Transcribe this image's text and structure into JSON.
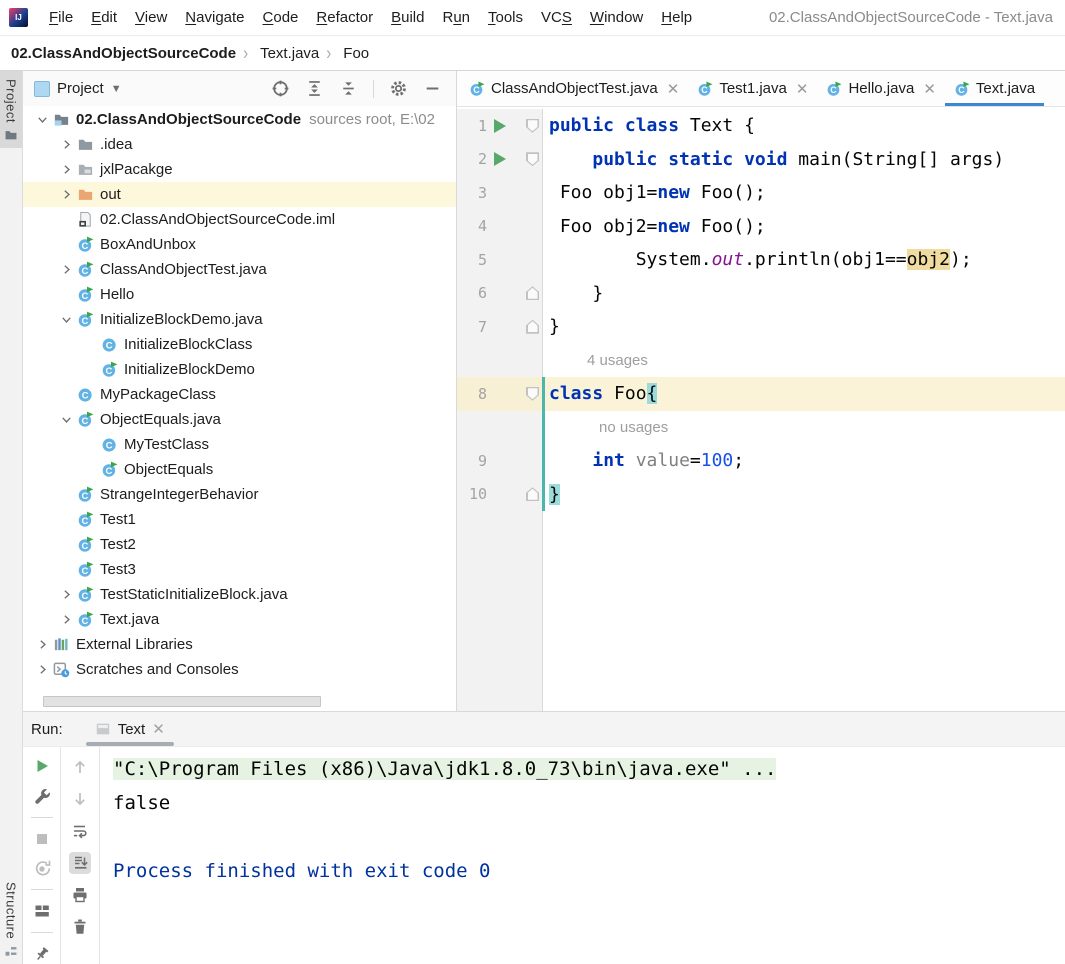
{
  "window": {
    "title": "02.ClassAndObjectSourceCode - Text.java"
  },
  "menubar": {
    "items": [
      "File",
      "Edit",
      "View",
      "Navigate",
      "Code",
      "Refactor",
      "Build",
      "Run",
      "Tools",
      "VCS",
      "Window",
      "Help"
    ],
    "mnemonics": [
      0,
      0,
      0,
      0,
      0,
      0,
      0,
      1,
      0,
      2,
      0,
      0
    ]
  },
  "breadcrumbs": [
    {
      "label": "02.ClassAndObjectSourceCode",
      "icon": null,
      "bold": true
    },
    {
      "label": "Text.java",
      "icon": "class-run",
      "bold": false
    },
    {
      "label": "Foo",
      "icon": "class",
      "bold": false
    }
  ],
  "left_stripe": {
    "top_label": "Project",
    "bottom_label": "Structure"
  },
  "project_panel": {
    "title": "Project",
    "toolbar_icons": [
      "locate",
      "expand-all",
      "collapse-all",
      "divider",
      "settings-gear",
      "hide"
    ],
    "tree": [
      {
        "label": "02.ClassAndObjectSourceCode",
        "hint": "sources root,  E:\\02",
        "icon": "folder-source",
        "chevron": "down",
        "level": 0,
        "bold": true
      },
      {
        "label": ".idea",
        "icon": "folder",
        "chevron": "right",
        "level": 1
      },
      {
        "label": "jxlPacakge",
        "icon": "folder-excluded",
        "chevron": "right",
        "level": 1
      },
      {
        "label": "out",
        "icon": "folder-out",
        "chevron": "right",
        "level": 1,
        "selected": true
      },
      {
        "label": "02.ClassAndObjectSourceCode.iml",
        "icon": "file-iml",
        "level": 1
      },
      {
        "label": "BoxAndUnbox",
        "icon": "class-run",
        "level": 1
      },
      {
        "label": "ClassAndObjectTest.java",
        "icon": "class-run",
        "chevron": "right",
        "level": 1
      },
      {
        "label": "Hello",
        "icon": "class-run",
        "level": 1
      },
      {
        "label": "InitializeBlockDemo.java",
        "icon": "class-run",
        "chevron": "down",
        "level": 1
      },
      {
        "label": "InitializeBlockClass",
        "icon": "class",
        "level": 2
      },
      {
        "label": "InitializeBlockDemo",
        "icon": "class-run",
        "level": 2
      },
      {
        "label": "MyPackageClass",
        "icon": "class",
        "level": 1
      },
      {
        "label": "ObjectEquals.java",
        "icon": "class-run",
        "chevron": "down",
        "level": 1
      },
      {
        "label": "MyTestClass",
        "icon": "class",
        "level": 2
      },
      {
        "label": "ObjectEquals",
        "icon": "class-run",
        "level": 2
      },
      {
        "label": "StrangeIntegerBehavior",
        "icon": "class-run",
        "level": 1
      },
      {
        "label": "Test1",
        "icon": "class-run",
        "level": 1
      },
      {
        "label": "Test2",
        "icon": "class-run",
        "level": 1
      },
      {
        "label": "Test3",
        "icon": "class-run",
        "level": 1
      },
      {
        "label": "TestStaticInitializeBlock.java",
        "icon": "class-run",
        "chevron": "right",
        "level": 1
      },
      {
        "label": "Text.java",
        "icon": "class-run",
        "chevron": "right",
        "level": 1
      },
      {
        "label": "External Libraries",
        "icon": "libraries",
        "chevron": "right",
        "level": 0
      },
      {
        "label": "Scratches and Consoles",
        "icon": "scratches",
        "chevron": "right",
        "level": 0
      }
    ]
  },
  "editor": {
    "tabs": [
      {
        "label": "ClassAndObjectTest.java",
        "icon": "class-run",
        "closable": true,
        "active": false
      },
      {
        "label": "Test1.java",
        "icon": "class-run",
        "closable": true,
        "active": false
      },
      {
        "label": "Hello.java",
        "icon": "class-run",
        "closable": true,
        "active": false
      },
      {
        "label": "Text.java",
        "icon": "class-run",
        "closable": false,
        "active": true
      }
    ],
    "rows": [
      {
        "type": "code",
        "num": "1",
        "run": true,
        "fold": "down",
        "segments": [
          [
            "public class",
            "kw"
          ],
          [
            " Text {",
            "plain"
          ]
        ]
      },
      {
        "type": "code",
        "num": "2",
        "run": true,
        "fold": "down",
        "segments": [
          [
            "    ",
            "plain"
          ],
          [
            "public static void",
            "kw"
          ],
          [
            " main(String[] args)",
            "plain"
          ]
        ]
      },
      {
        "type": "code",
        "num": "3",
        "segments": [
          [
            " Foo obj1=",
            "plain"
          ],
          [
            "new",
            "kw"
          ],
          [
            " Foo();",
            "plain"
          ]
        ]
      },
      {
        "type": "code",
        "num": "4",
        "segments": [
          [
            " Foo obj2=",
            "plain"
          ],
          [
            "new",
            "kw"
          ],
          [
            " Foo();",
            "plain"
          ]
        ]
      },
      {
        "type": "code",
        "num": "5",
        "segments": [
          [
            "        System.",
            "plain"
          ],
          [
            "out",
            "field"
          ],
          [
            ".println(obj1==",
            "plain"
          ],
          [
            "obj2",
            "hl"
          ],
          [
            ");",
            "plain"
          ]
        ]
      },
      {
        "type": "code",
        "num": "6",
        "fold": "up",
        "segments": [
          [
            "    }",
            "plain"
          ]
        ]
      },
      {
        "type": "code",
        "num": "7",
        "fold": "up",
        "segments": [
          [
            "}",
            "plain"
          ]
        ]
      },
      {
        "type": "inlay",
        "text": "4 usages",
        "indent": 38
      },
      {
        "type": "code",
        "num": "8",
        "fold": "down",
        "caret_row": true,
        "vcs": true,
        "segments": [
          [
            "class",
            "kw"
          ],
          [
            " Foo",
            "plain"
          ],
          [
            "{",
            "brace"
          ]
        ]
      },
      {
        "type": "inlay",
        "text": "no usages",
        "indent": 50,
        "vcs": true
      },
      {
        "type": "code",
        "num": "9",
        "vcs": true,
        "segments": [
          [
            "    ",
            "plain"
          ],
          [
            "int",
            "kw"
          ],
          [
            " ",
            "plain"
          ],
          [
            "value",
            "gray"
          ],
          [
            "=",
            "plain"
          ],
          [
            "100",
            "num"
          ],
          [
            ";",
            "plain"
          ]
        ]
      },
      {
        "type": "code",
        "num": "10",
        "fold": "up",
        "vcs": true,
        "segments": [
          [
            "}",
            "brace"
          ]
        ]
      }
    ]
  },
  "run_panel": {
    "label": "Run:",
    "tab": {
      "label": "Text",
      "icon": "console"
    },
    "toolbar_left": [
      {
        "name": "rerun"
      },
      {
        "name": "settings-wrench"
      },
      {
        "name": "divider"
      },
      {
        "name": "stop",
        "disabled": true
      },
      {
        "name": "restart-debug",
        "disabled": true
      },
      {
        "name": "divider"
      },
      {
        "name": "layout"
      },
      {
        "name": "divider"
      },
      {
        "name": "pin"
      }
    ],
    "toolbar_right": [
      {
        "name": "scroll-up",
        "disabled": true
      },
      {
        "name": "scroll-down",
        "disabled": true
      },
      {
        "name": "soft-wrap"
      },
      {
        "name": "scroll-end",
        "selected": true
      },
      {
        "name": "print"
      },
      {
        "name": "clear"
      }
    ],
    "console": [
      {
        "text": "\"C:\\Program Files (x86)\\Java\\jdk1.8.0_73\\bin\\java.exe\" ...",
        "style": "cmd"
      },
      {
        "text": "false",
        "style": "plain"
      },
      {
        "text": "",
        "style": "plain"
      },
      {
        "text": "Process finished with exit code 0",
        "style": "system"
      }
    ]
  },
  "colors": {
    "accent_blue": "#3d87d0",
    "keyword": "#0033b3",
    "number": "#1750eb",
    "static_field": "#871094",
    "unused_gray": "#808080",
    "caret_row": "#fbf3d8",
    "tree_selection": "#fdf7dc",
    "write_highlight": "#f0dca0",
    "brace_highlight": "#9bdbdb",
    "console_cmd_bg": "#e6f3e2",
    "system_output_blue": "#00329e",
    "run_green": "#59a869",
    "vcs_marker": "#4db6ac"
  }
}
